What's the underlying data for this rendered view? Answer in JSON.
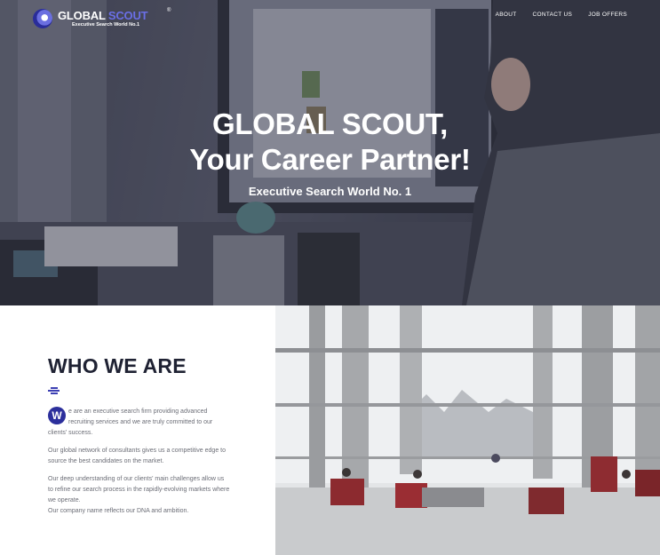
{
  "brand": {
    "name_part1": "GLOBAL",
    "name_part2": "SCOUT",
    "registered": "®",
    "tagline": "Executive Search World No.1",
    "primary_color": "#2c2f9c",
    "accent_color": "#6a6fe6"
  },
  "nav": {
    "items": [
      {
        "label": "ABOUT"
      },
      {
        "label": "CONTACT US"
      },
      {
        "label": "JOB OFFERS"
      }
    ]
  },
  "hero": {
    "title_line1": "GLOBAL SCOUT,",
    "title_line2": "Your Career Partner!",
    "subtitle": "Executive Search World No. 1"
  },
  "about": {
    "title": "WHO WE ARE",
    "drop_cap": "W",
    "para1_rest": "e are an executive search firm providing advanced recruiting services and we are truly committed to our clients' success.",
    "para2": "Our global network of consultants gives us a competitive edge to source the best candidates on the market.",
    "para3": "Our deep understanding of our clients' main challenges allow us to refine our search process in the rapidly-evolving markets where we operate.",
    "para4": "Our company name reflects our DNA and ambition."
  }
}
